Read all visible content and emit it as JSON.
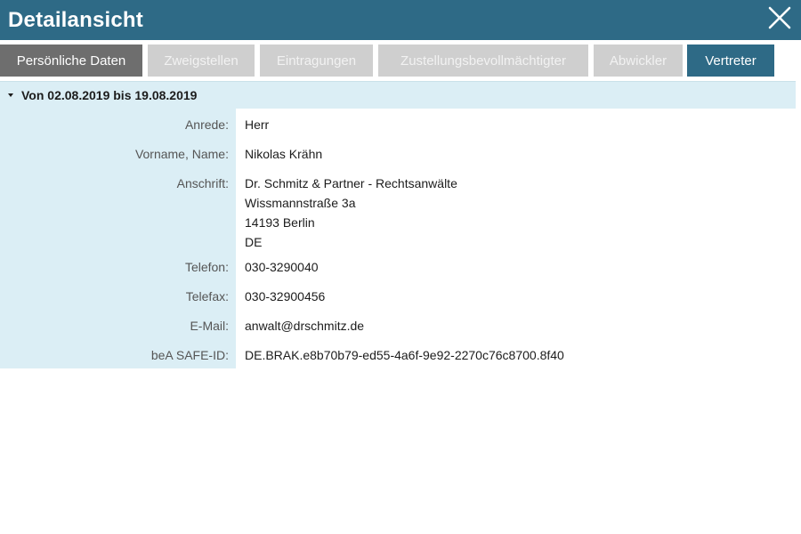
{
  "window": {
    "title": "Detailansicht",
    "close_icon": "close-icon",
    "colors": {
      "titlebar": "#2e6a86",
      "tab_active": "#6e6e6e",
      "tab_disabled": "#cfcfcf",
      "label_background": "#dbeef5"
    }
  },
  "tabs": [
    {
      "label": "Persönliche Daten",
      "state": "active"
    },
    {
      "label": "Zweigstellen",
      "state": "disabled"
    },
    {
      "label": "Eintragungen",
      "state": "disabled"
    },
    {
      "label": "Zustellungsbevollmächtigter",
      "state": "disabled"
    },
    {
      "label": "Abwickler",
      "state": "disabled"
    },
    {
      "label": "Vertreter",
      "state": "enabled"
    }
  ],
  "section": {
    "title": "Von 02.08.2019 bis 19.08.2019",
    "expanded": true
  },
  "fields": {
    "anrede": {
      "label": "Anrede:",
      "value": "Herr"
    },
    "name": {
      "label": "Vorname, Name:",
      "value": "Nikolas Krähn"
    },
    "anschrift": {
      "label": "Anschrift:",
      "lines": [
        "Dr. Schmitz & Partner - Rechtsanwälte",
        "Wissmannstraße 3a",
        "14193 Berlin",
        "DE"
      ]
    },
    "telefon": {
      "label": "Telefon:",
      "value": "030-3290040"
    },
    "telefax": {
      "label": "Telefax:",
      "value": "030-32900456"
    },
    "email": {
      "label": "E-Mail:",
      "value": "anwalt@drschmitz.de"
    },
    "safe_id": {
      "label": "beA SAFE-ID:",
      "value": "DE.BRAK.e8b70b79-ed55-4a6f-9e92-2270c76c8700.8f40"
    }
  }
}
